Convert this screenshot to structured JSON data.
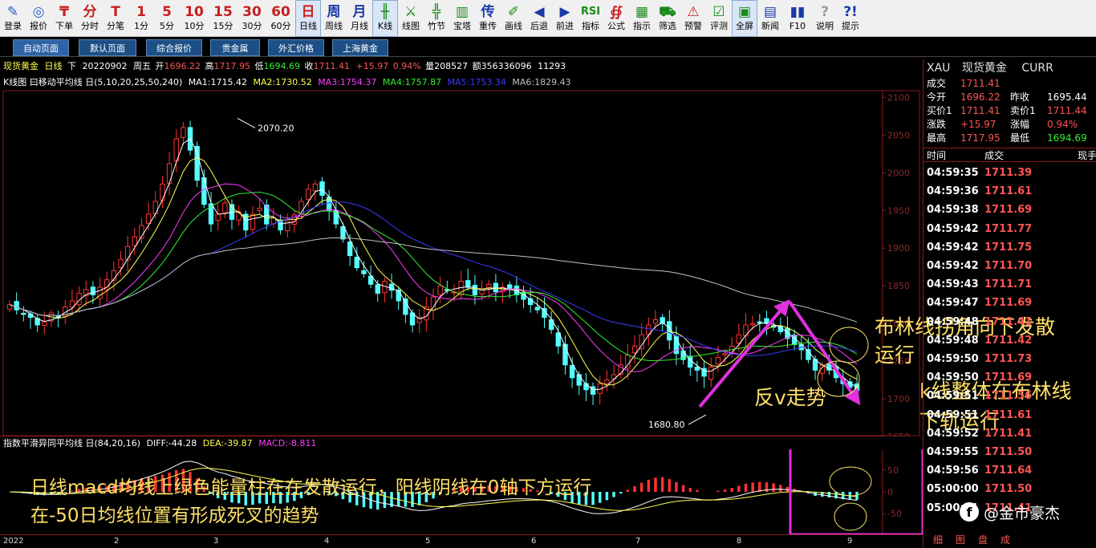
{
  "toolbar": {
    "items": [
      {
        "label": "登录",
        "icon": "✎",
        "name": "login",
        "color": "#2a62c8"
      },
      {
        "label": "报价",
        "icon": "◎",
        "name": "quote",
        "color": "#2a62c8"
      },
      {
        "label": "下单",
        "icon": "₸",
        "name": "order",
        "color": "#c81e1e"
      },
      {
        "label": "分时",
        "icon": "分",
        "name": "intraday",
        "color": "#c81e1e"
      },
      {
        "label": "分笔",
        "icon": "T",
        "name": "tick",
        "color": "#c81e1e"
      },
      {
        "label": "1分",
        "icon": "1",
        "name": "period-1m",
        "color": "#c81e1e"
      },
      {
        "label": "5分",
        "icon": "5",
        "name": "period-5m",
        "color": "#c81e1e"
      },
      {
        "label": "10分",
        "icon": "10",
        "name": "period-10m",
        "color": "#c81e1e"
      },
      {
        "label": "15分",
        "icon": "15",
        "name": "period-15m",
        "color": "#c81e1e"
      },
      {
        "label": "30分",
        "icon": "30",
        "name": "period-30m",
        "color": "#c81e1e"
      },
      {
        "label": "60分",
        "icon": "60",
        "name": "period-60m",
        "color": "#c81e1e"
      },
      {
        "label": "日线",
        "icon": "日",
        "name": "period-day",
        "color": "#c81e1e",
        "active": true
      },
      {
        "label": "周线",
        "icon": "周",
        "name": "period-week",
        "color": "#1a3aa8"
      },
      {
        "label": "月线",
        "icon": "月",
        "name": "period-month",
        "color": "#1a3aa8"
      },
      {
        "label": "K线",
        "icon": "╫",
        "name": "kline",
        "color": "#1a8a1a",
        "active": true
      },
      {
        "label": "线图",
        "icon": "⚔",
        "name": "line-chart",
        "color": "#1a8a1a"
      },
      {
        "label": "竹节",
        "icon": "╬",
        "name": "bamboo",
        "color": "#1a8a1a"
      },
      {
        "label": "宝塔",
        "icon": "▥",
        "name": "tower",
        "color": "#1a8a1a"
      },
      {
        "label": "重传",
        "icon": "传",
        "name": "reload",
        "color": "#1a3aa8"
      },
      {
        "label": "画线",
        "icon": "✐",
        "name": "draw-line",
        "color": "#1a8a1a"
      },
      {
        "label": "后退",
        "icon": "◀",
        "name": "back",
        "color": "#1a3aa8"
      },
      {
        "label": "前进",
        "icon": "▶",
        "name": "forward",
        "color": "#1a3aa8"
      },
      {
        "label": "指标",
        "icon": "RSI",
        "name": "indicator",
        "color": "#1a8a1a"
      },
      {
        "label": "公式",
        "icon": "∯",
        "name": "formula",
        "color": "#c81e1e"
      },
      {
        "label": "指示",
        "icon": "▦",
        "name": "indicate",
        "color": "#1a8a1a"
      },
      {
        "label": "筛选",
        "icon": "⛟",
        "name": "filter",
        "color": "#1a8a1a"
      },
      {
        "label": "预警",
        "icon": "⚠",
        "name": "alert",
        "color": "#c81e1e"
      },
      {
        "label": "评测",
        "icon": "☑",
        "name": "evaluate",
        "color": "#1a8a1a"
      },
      {
        "label": "全屏",
        "icon": "▣",
        "name": "fullscreen",
        "color": "#1a8a1a",
        "active": true
      },
      {
        "label": "新闻",
        "icon": "▤",
        "name": "news",
        "color": "#1a3aa8"
      },
      {
        "label": "F10",
        "icon": "▮▮",
        "name": "f10",
        "color": "#1a3aa8"
      },
      {
        "label": "说明",
        "icon": "?",
        "name": "help-desc",
        "color": "#9a9a9a"
      },
      {
        "label": "提示",
        "icon": "?!",
        "name": "hint",
        "color": "#1a3aa8"
      }
    ]
  },
  "tabs": [
    {
      "label": "自动页面",
      "selected": true
    },
    {
      "label": "默认页面"
    },
    {
      "label": "综合报价"
    },
    {
      "label": "贵金属"
    },
    {
      "label": "外汇价格"
    },
    {
      "label": "上海黄金"
    }
  ],
  "header": {
    "symbol": "现货黄金",
    "period": "日线",
    "mode": "下",
    "date": "20220902",
    "weekday": "周五",
    "open_label": "开",
    "open": "1696.22",
    "high_label": "高",
    "high": "1717.95",
    "low_label": "低",
    "low": "1694.69",
    "close_label": "收",
    "close": "1711.41",
    "change": "+15.97",
    "change_pct": "0.94%",
    "vol_label": "量",
    "volume": "208527",
    "amt_label": "额",
    "amount": "356336096",
    "extra": "11293"
  },
  "ma_legend": {
    "title": "K线图 曰移动平均线 日(5,10,20,25,50,240)",
    "items": [
      {
        "text": "MA1:1715.42",
        "color": "#ffffff"
      },
      {
        "text": "MA2:1730.52",
        "color": "#ffff4d"
      },
      {
        "text": "MA3:1754.37",
        "color": "#ff3cff"
      },
      {
        "text": "MA4:1757.87",
        "color": "#33ee33"
      },
      {
        "text": "MA5:1753.34",
        "color": "#3a3aff"
      },
      {
        "text": "MA6:1829.43",
        "color": "#c0c0c0"
      }
    ]
  },
  "chart_data": [
    {
      "type": "candlestick",
      "title": "现货黄金 日线",
      "ylim": [
        1650,
        2110
      ],
      "y_ticks": [
        2100,
        2050,
        2000,
        1950,
        1900,
        1850,
        1800,
        1750,
        1700,
        1650
      ],
      "x_ticks": [
        "2022",
        "2",
        "3",
        "4",
        "5",
        "6",
        "7",
        "8",
        "9"
      ],
      "annotations": [
        {
          "text": "2070.20",
          "value": 2070.2,
          "kind": "high"
        },
        {
          "text": "1680.80",
          "value": 1680.8,
          "kind": "low"
        }
      ],
      "series_colors": {
        "up": "#ff3232",
        "down": "#54ffff",
        "ma1": "#ffffff",
        "ma2": "#ffff4d",
        "ma3": "#ff3cff",
        "ma4": "#33ee33",
        "ma5": "#3a3aff",
        "ma6": "#c0c0c0"
      },
      "close_path": [
        1825,
        1818,
        1812,
        1808,
        1798,
        1802,
        1814,
        1808,
        1822,
        1830,
        1840,
        1845,
        1838,
        1848,
        1858,
        1870,
        1885,
        1902,
        1915,
        1930,
        1945,
        1962,
        1985,
        2012,
        2045,
        2060,
        2030,
        1990,
        1958,
        1932,
        1945,
        1960,
        1938,
        1948,
        1924,
        1945,
        1953,
        1932,
        1940,
        1924,
        1936,
        1944,
        1962,
        1978,
        1985,
        1970,
        1950,
        1932,
        1912,
        1890,
        1874,
        1866,
        1852,
        1840,
        1856,
        1844,
        1830,
        1812,
        1798,
        1808,
        1822,
        1835,
        1850,
        1845,
        1842,
        1856,
        1848,
        1838,
        1846,
        1852,
        1842,
        1848,
        1845,
        1838,
        1832,
        1825,
        1818,
        1808,
        1792,
        1770,
        1745,
        1728,
        1718,
        1712,
        1706,
        1720,
        1725,
        1732,
        1745,
        1758,
        1770,
        1785,
        1798,
        1805,
        1800,
        1778,
        1760,
        1752,
        1742,
        1738,
        1730,
        1742,
        1755,
        1760,
        1770,
        1785,
        1798,
        1800,
        1802,
        1800,
        1795,
        1789,
        1780,
        1772,
        1765,
        1752,
        1738,
        1745,
        1738,
        1728,
        1720,
        1715,
        1711
      ]
    },
    {
      "type": "macd",
      "title": "指数平滑异同平均线 日(84,20,16)",
      "ylim": [
        -90,
        90
      ],
      "y_ticks": [
        50,
        0,
        -50
      ],
      "diff": -44.28,
      "dea": -39.87,
      "macd": -8.811
    }
  ],
  "macd_legend": {
    "title": "指数平滑异同平均线 日(84,20,16)",
    "diff": "DIFF:-44.28",
    "dea": "DEA:-39.87",
    "macd": "MACD:-8.811"
  },
  "right_panel": {
    "symbol": "XAU",
    "name": "现货黄金",
    "currency": "CURR",
    "quotes": [
      {
        "l1": "成交",
        "v1": "1711.41",
        "c1": "#ff5555"
      },
      {
        "l1": "今开",
        "v1": "1696.22",
        "c1": "#ff5555",
        "l2": "昨收",
        "v2": "1695.44",
        "c2": "#ffffff"
      },
      {
        "l1": "买价1",
        "v1": "1711.41",
        "c1": "#ff5555",
        "l2": "卖价1",
        "v2": "1711.44",
        "c2": "#ff5555"
      },
      {
        "l1": "涨跌",
        "v1": "+15.97",
        "c1": "#ff5555",
        "l2": "涨幅",
        "v2": "0.94%",
        "c2": "#ff5555"
      },
      {
        "l1": "最高",
        "v1": "1717.95",
        "c1": "#ff5555",
        "l2": "最低",
        "v2": "1694.69",
        "c2": "#33ee33"
      }
    ],
    "tick_header": {
      "time": "时间",
      "price": "成交",
      "now": "现手"
    },
    "ticks": [
      {
        "time": "04:59:35",
        "price": "1711.39"
      },
      {
        "time": "04:59:36",
        "price": "1711.61"
      },
      {
        "time": "04:59:38",
        "price": "1711.69"
      },
      {
        "time": "04:59:42",
        "price": "1711.77"
      },
      {
        "time": "04:59:42",
        "price": "1711.75"
      },
      {
        "time": "04:59:42",
        "price": "1711.70"
      },
      {
        "time": "04:59:43",
        "price": "1711.71"
      },
      {
        "time": "04:59:47",
        "price": "1711.69"
      },
      {
        "time": "04:59:48",
        "price": "1711.41"
      },
      {
        "time": "04:59:48",
        "price": "1711.42"
      },
      {
        "time": "04:59:50",
        "price": "1711.73"
      },
      {
        "time": "04:59:50",
        "price": "1711.69"
      },
      {
        "time": "04:59:51",
        "price": "1711.56"
      },
      {
        "time": "04:59:51",
        "price": "1711.61"
      },
      {
        "time": "04:59:52",
        "price": "1711.41"
      },
      {
        "time": "04:59:55",
        "price": "1711.50"
      },
      {
        "time": "04:59:56",
        "price": "1711.64"
      },
      {
        "time": "05:00:00",
        "price": "1711.50"
      },
      {
        "time": "05:00:01",
        "price": "1711.41"
      }
    ],
    "bottom_tabs": [
      "细",
      "图",
      "盘",
      "成"
    ]
  },
  "annotations": {
    "bollinger_turn": "布林线拐角向下发散",
    "bollinger_turn_2": "运行",
    "inverse_v": "反v走势",
    "kline_overall": "k线整体在布林线",
    "kline_overall_2": "下轨运行",
    "macd_note_1": "日线macd均线上绿色能量柱在在发散运行，阳线阴线在0轴下方运行",
    "macd_note_2": "在-50日均线位置有形成死叉的趋势"
  },
  "watermark": {
    "logo": "f",
    "text": "@金市豪杰"
  }
}
